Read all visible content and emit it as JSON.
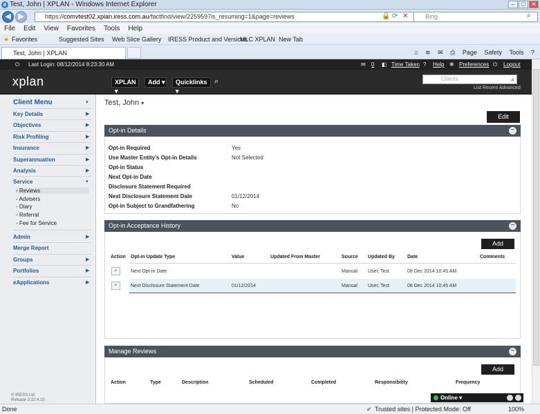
{
  "browser": {
    "window_title": "Test, John | XPLAN - Windows Internet Explorer",
    "url_prefix": "https://",
    "url_host": "comvtest02.xplan.iress.com.au",
    "url_path": "/factfind/view/2259597is_resuming=1&page=reviews",
    "search_placeholder": "Bing",
    "menu": [
      "File",
      "Edit",
      "View",
      "Favorites",
      "Tools",
      "Help"
    ],
    "favorites_label": "Favorites",
    "favorites_items": [
      "Suggested Sites",
      "Web Slice Gallery",
      "IRESS Product and Versions",
      "MLC XPLAN",
      "New Tab"
    ],
    "tab_title": "Test, John | XPLAN",
    "command_items": [
      "Page",
      "Safety",
      "Tools"
    ],
    "status_left": "Done",
    "status_zone": "Trusted sites | Protected Mode: Off",
    "zoom": "100%"
  },
  "app": {
    "last_login": "Last Login: 08/12/2014 8:23:30 AM",
    "inbox_count": "0",
    "time_taken": "Time Taken",
    "help": "Help",
    "preferences": "Preferences",
    "logout": "Logout",
    "logo": "xplan",
    "nav_buttons": [
      "XPLAN",
      "Add",
      "Quicklinks"
    ],
    "client_search_placeholder": "Clients",
    "search_links": "List  Recent  Advanced"
  },
  "sidebar": {
    "title": "Client Menu",
    "items": [
      {
        "label": "Key Details"
      },
      {
        "label": "Objectives"
      },
      {
        "label": "Risk Profiling"
      },
      {
        "label": "Insurance"
      },
      {
        "label": "Superannuation"
      },
      {
        "label": "Analysis"
      },
      {
        "label": "Service"
      }
    ],
    "service_sub": [
      "- Reviews",
      "- Advisers",
      "- Diary",
      "- Referral",
      "- Fee for Service"
    ],
    "items2": [
      {
        "label": "Admin"
      },
      {
        "label": "Merge Report"
      },
      {
        "label": "Groups"
      },
      {
        "label": "Portfolios"
      },
      {
        "label": "eApplications"
      }
    ],
    "copyright": "© IRESS Ltd",
    "release": "Release 2.10.4.10"
  },
  "main": {
    "client_name": "Test, John",
    "edit_label": "Edit",
    "optin": {
      "title": "Opt-in Details",
      "fields": [
        {
          "label": "Opt-in Required",
          "value": "Yes"
        },
        {
          "label": "Use Master Entity's Opt-in Details",
          "value": "Not Selected"
        },
        {
          "label": "Opt-in Status",
          "value": ""
        },
        {
          "label": "Next Opt-in Date",
          "value": ""
        },
        {
          "label": "Disclosure Statement Required",
          "value": ""
        },
        {
          "label": "Next Disclosure Statement Date",
          "value": "01/12/2014"
        },
        {
          "label": "Opt-in Subject to Grandfathering",
          "value": "No"
        }
      ]
    },
    "history": {
      "title": "Opt-in Acceptance History",
      "add_label": "Add",
      "columns": [
        "Action",
        "Opt-in Update Type",
        "Value",
        "Updated From Master",
        "Source",
        "Updated By",
        "Date",
        "Comments"
      ],
      "rows": [
        {
          "type": "Next Opt-in Date",
          "value": "",
          "master": "",
          "source": "Manual",
          "by": "User, Test",
          "date": "08 Dec 2014 10:45 AM",
          "comments": ""
        },
        {
          "type": "Next Disclosure Statement Date",
          "value": "01/12/2014",
          "master": "",
          "source": "Manual",
          "by": "User, Test",
          "date": "08 Dec 2014 10:45 AM",
          "comments": ""
        }
      ]
    },
    "reviews": {
      "title": "Manage Reviews",
      "add_label": "Add",
      "columns": [
        "Action",
        "Type",
        "Description",
        "Scheduled",
        "Completed",
        "Responsibility",
        "Frequency"
      ]
    }
  },
  "online_label": "Online"
}
